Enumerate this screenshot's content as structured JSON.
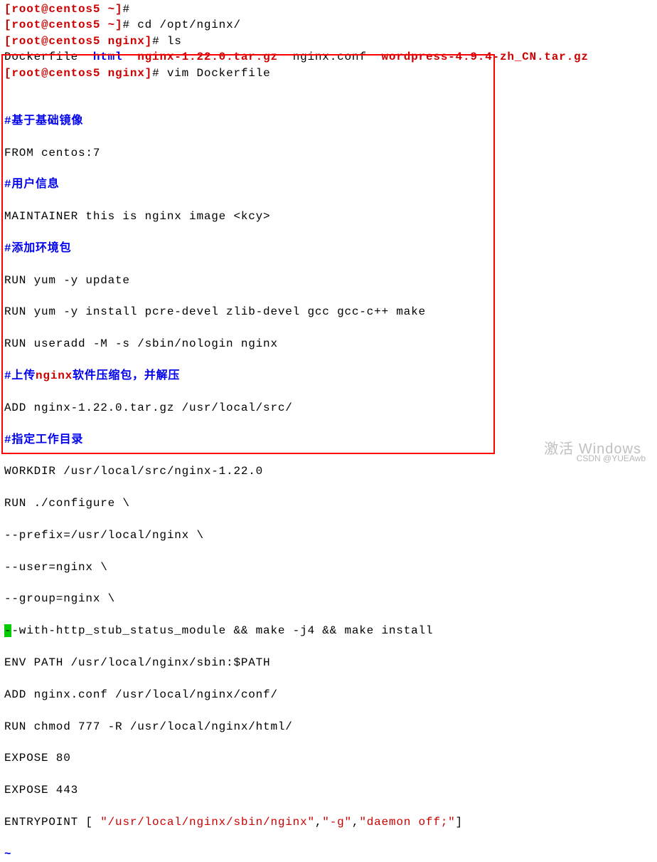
{
  "prompt": {
    "open": "[",
    "user": "root@centos5",
    "space": " ",
    "tilde": "~",
    "dir_nginx": "nginx",
    "close": "]",
    "hash": "#"
  },
  "cmd1": "cd /opt/nginx/",
  "cmd2": "ls",
  "ls_out": {
    "f1": "Dockerfile",
    "f2": "html",
    "f3": "nginx-1.22.0.tar.gz",
    "f4": "nginx.conf",
    "f5": "wordpress-4.9.4-zh_CN.tar.gz"
  },
  "cmd3": "vim Dockerfile",
  "dockerfile": {
    "c1": "#基于基础镜像",
    "l1": "FROM centos:7",
    "c2": "#用户信息",
    "l2": "MAINTAINER this is nginx image <kcy>",
    "c3": "#添加环境包",
    "l3": "RUN yum -y update",
    "l4": "RUN yum -y install pcre-devel zlib-devel gcc gcc-c++ make",
    "l5": "RUN useradd -M -s /sbin/nologin nginx",
    "c4a": "#上传",
    "c4kw": "nginx",
    "c4b": "软件压缩包，并解压",
    "l6": "ADD nginx-1.22.0.tar.gz /usr/local/src/",
    "c5": "#指定工作目录",
    "l7": "WORKDIR /usr/local/src/nginx-1.22.0",
    "l8": "RUN ./configure \\",
    "l9": "--prefix=/usr/local/nginx \\",
    "l10": "--user=nginx \\",
    "l11": "--group=nginx \\",
    "l12a": "-",
    "l12b": "-with-http_stub_status_module && make -j4 && make install",
    "l13": "ENV PATH /usr/local/nginx/sbin:$PATH",
    "l14": "ADD nginx.conf /usr/local/nginx/conf/",
    "l15": "RUN chmod 777 -R /usr/local/nginx/html/",
    "l16": "EXPOSE 80",
    "l17": "EXPOSE 443",
    "l18a": "ENTRYPOINT [ ",
    "l18b": "\"/usr/local/nginx/sbin/nginx\"",
    "l18c": ",",
    "l18d": "\"-g\"",
    "l18e": ",",
    "l18f": "\"daemon off;\"",
    "l18g": "]"
  },
  "tilde": "~",
  "watermark": "CSDN @YUEAwb",
  "activate": "激活 Windows"
}
